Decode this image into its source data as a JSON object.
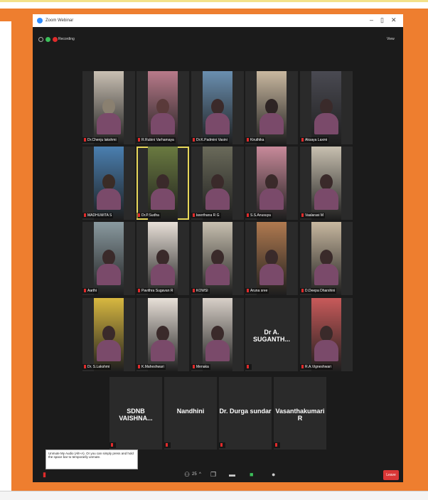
{
  "window": {
    "title": "Zoom Webinar",
    "view_label": "View",
    "recording_label": "Recording"
  },
  "tiles": [
    {
      "name": "Dr.Chenju lakshmi",
      "tone": "#8a8070",
      "bg": "#c9c0b3"
    },
    {
      "name": "R.Rubini Varhamaya",
      "tone": "#5a3a3a",
      "bg": "#b87a8a"
    },
    {
      "name": "Dr.K.Padmini Vasini",
      "tone": "#3b2a2a",
      "bg": "#6a8fb0"
    },
    {
      "name": "Kiruthika",
      "tone": "#2e2424",
      "bg": "#c9b8a0"
    },
    {
      "name": "Aksaya Laxmi",
      "tone": "#3a2a2a",
      "bg": "#4a4a52"
    },
    {
      "name": "MADHUMITA S",
      "tone": "#3a2c26",
      "bg": "#4a7fb0"
    },
    {
      "name": "Dr.P.Sudha",
      "tone": "#3a2a2a",
      "bg": "#6a7a40"
    },
    {
      "name": "keerthana R G",
      "tone": "#3a2a2a",
      "bg": "#6a6a5a"
    },
    {
      "name": "S.S.Anusuya",
      "tone": "#3a2a2a",
      "bg": "#c88a9a"
    },
    {
      "name": "Vaalarasi M",
      "tone": "#3a2a2a",
      "bg": "#c8c0b0"
    },
    {
      "name": "Aarthi",
      "tone": "#3a2a2a",
      "bg": "#8a9aa0"
    },
    {
      "name": "Pavithra Sugavan R",
      "tone": "#3a2a2a",
      "bg": "#e8e0d8"
    },
    {
      "name": "KOWSI",
      "tone": "#3a2a2a",
      "bg": "#c8c0b0"
    },
    {
      "name": "Aruna sree",
      "tone": "#3a2a2a",
      "bg": "#b07a50"
    },
    {
      "name": "D.Deepa Dharshini",
      "tone": "#3a2a2a",
      "bg": "#c8b8a0"
    },
    {
      "name": "Dr. S.Lakshmi",
      "tone": "#3a2a2a",
      "bg": "#d8b840"
    },
    {
      "name": "K.Maheshwari",
      "tone": "#3a2a2a",
      "bg": "#e8e0d8"
    },
    {
      "name": "Menaka",
      "tone": "#3a2a2a",
      "bg": "#d8d0c8"
    },
    {
      "name": "",
      "big": "Dr A. SUGANTH...",
      "tone": "",
      "bg": "#2a2a2a"
    },
    {
      "name": "R.A.Vigneshwari",
      "tone": "#3a2a2a",
      "bg": "#c85a5a"
    }
  ],
  "bottom_tiles": [
    {
      "big": "SDNB VAISHNA..."
    },
    {
      "big": "Nandhini"
    },
    {
      "big": "Dr. Durga sundar"
    },
    {
      "big": "Vasanthakumari R"
    }
  ],
  "tooltip_text": "Unmute My Audio (Alt+A). Or you can simply press and hold the space bar to temporarily unmute.",
  "participants_count": "25",
  "leave_label": "Leave"
}
